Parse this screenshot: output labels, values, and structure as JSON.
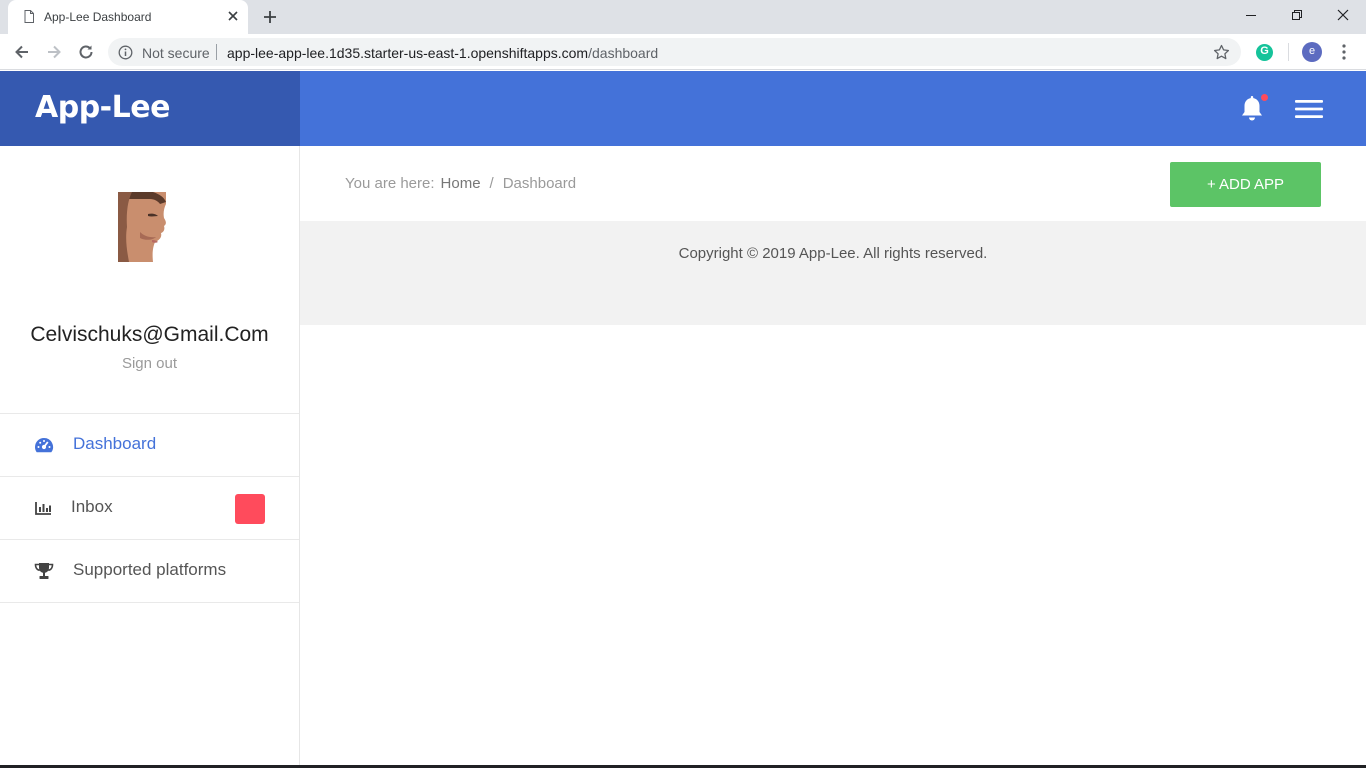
{
  "browser": {
    "tab_title": "App-Lee Dashboard",
    "security_label": "Not secure",
    "url_host": "app-lee-app-lee.1d35.starter-us-east-1.openshiftapps.com",
    "url_path": "/dashboard",
    "profile_initial": "e",
    "extension_initial": "G"
  },
  "header": {
    "brand": "App-Lee",
    "accent_color": "#4472d9",
    "brand_bg": "#3559b0"
  },
  "sidebar": {
    "user_email": "Celvischuks@Gmail.Com",
    "sign_out": "Sign out",
    "items": [
      {
        "label": "Dashboard",
        "icon": "dashboard-gauge-icon",
        "active": true
      },
      {
        "label": "Inbox",
        "icon": "bar-chart-icon",
        "badge_color": "#ff4b5c"
      },
      {
        "label": "Supported platforms",
        "icon": "trophy-icon"
      }
    ]
  },
  "main": {
    "breadcrumb": {
      "prefix": "You are here:",
      "home": "Home",
      "separator": "/",
      "current": "Dashboard"
    },
    "add_button": "+ ADD APP",
    "add_button_color": "#5cc466",
    "copyright": "Copyright © 2019 App-Lee. All rights reserved."
  }
}
